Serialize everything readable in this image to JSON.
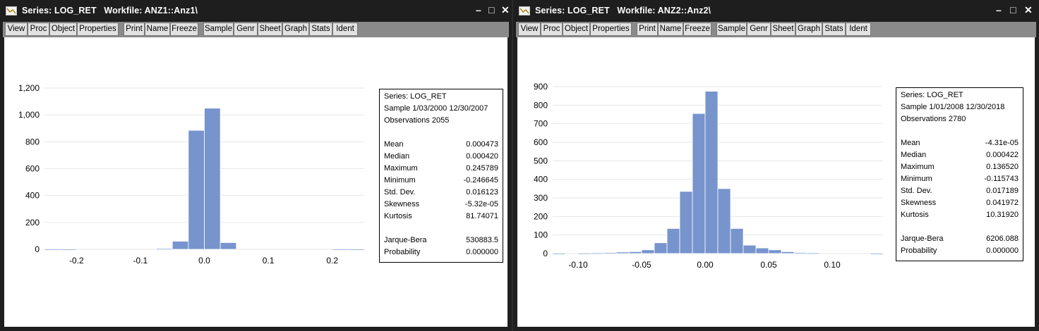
{
  "toolbar_buttons": [
    "View",
    "Proc",
    "Object",
    "Properties",
    "Print",
    "Name",
    "Freeze",
    "Sample",
    "Genr",
    "Sheet",
    "Graph",
    "Stats",
    "Ident"
  ],
  "window_controls": {
    "minimize": "–",
    "maximize": "□",
    "close": "✕"
  },
  "icons": {
    "title": "series-icon"
  },
  "colors": {
    "bar": "#7794cd",
    "bar_edge": "#ffffff",
    "grid": "#e6e6e6",
    "title_bg": "#1e1e1e",
    "toolbar_bg": "#8a8a8a"
  },
  "windows": [
    {
      "title": "Series: LOG_RET   Workfile: ANZ1::Anz1\\",
      "stats": {
        "series": "Series: LOG_RET",
        "sample": "Sample 1/03/2000 12/30/2007",
        "observations": "Observations 2055",
        "rows": [
          {
            "label": "Mean",
            "value": "0.000473"
          },
          {
            "label": "Median",
            "value": "0.000420"
          },
          {
            "label": "Maximum",
            "value": "0.245789"
          },
          {
            "label": "Minimum",
            "value": "-0.246645"
          },
          {
            "label": "Std. Dev.",
            "value": "0.016123"
          },
          {
            "label": "Skewness",
            "value": "-5.32e-05"
          },
          {
            "label": "Kurtosis",
            "value": "81.74071"
          }
        ],
        "tests": [
          {
            "label": "Jarque-Bera",
            "value": "530883.5"
          },
          {
            "label": "Probability",
            "value": "0.000000"
          }
        ]
      }
    },
    {
      "title": "Series: LOG_RET   Workfile: ANZ2::Anz2\\",
      "stats": {
        "series": "Series: LOG_RET",
        "sample": "Sample 1/01/2008 12/30/2018",
        "observations": "Observations 2780",
        "rows": [
          {
            "label": "Mean",
            "value": "-4.31e-05"
          },
          {
            "label": "Median",
            "value": "0.000422"
          },
          {
            "label": "Maximum",
            "value": "0.136520"
          },
          {
            "label": "Minimum",
            "value": "-0.115743"
          },
          {
            "label": "Std. Dev.",
            "value": "0.017189"
          },
          {
            "label": "Skewness",
            "value": "0.041972"
          },
          {
            "label": "Kurtosis",
            "value": "10.31920"
          }
        ],
        "tests": [
          {
            "label": "Jarque-Bera",
            "value": "6206.088"
          },
          {
            "label": "Probability",
            "value": "0.000000"
          }
        ]
      }
    }
  ],
  "chart_data": [
    {
      "type": "bar",
      "subtype": "histogram",
      "series_name": "LOG_RET",
      "bin_width": 0.025,
      "bin_start": -0.25,
      "bins": [
        -0.25,
        -0.225,
        -0.2,
        -0.175,
        -0.15,
        -0.125,
        -0.1,
        -0.075,
        -0.05,
        -0.025,
        0.0,
        0.025,
        0.05,
        0.075,
        0.1,
        0.125,
        0.15,
        0.175,
        0.2,
        0.225
      ],
      "values": [
        1,
        1,
        0,
        0,
        0,
        0,
        0,
        5,
        60,
        885,
        1050,
        50,
        0,
        0,
        0,
        0,
        0,
        0,
        1,
        1
      ],
      "xlim": [
        -0.25,
        0.25
      ],
      "ylim": [
        0,
        1200
      ],
      "yticks": [
        0,
        200,
        400,
        600,
        800,
        1000,
        1200
      ],
      "ytick_labels": [
        "0",
        "200",
        "400",
        "600",
        "800",
        "1,000",
        "1,200"
      ],
      "xticks": [
        -0.2,
        -0.1,
        0.0,
        0.1,
        0.2
      ],
      "xtick_labels": [
        "-0.2",
        "-0.1",
        "0.0",
        "0.1",
        "0.2"
      ],
      "grid": true
    },
    {
      "type": "bar",
      "subtype": "histogram",
      "series_name": "LOG_RET",
      "bin_width": 0.01,
      "bin_start": -0.12,
      "bins": [
        -0.12,
        -0.11,
        -0.1,
        -0.09,
        -0.08,
        -0.07,
        -0.06,
        -0.05,
        -0.04,
        -0.03,
        -0.02,
        -0.01,
        0.0,
        0.01,
        0.02,
        0.03,
        0.04,
        0.05,
        0.06,
        0.07,
        0.08,
        0.09,
        0.1,
        0.11,
        0.12,
        0.13
      ],
      "values": [
        1,
        0,
        2,
        3,
        5,
        8,
        10,
        20,
        58,
        135,
        335,
        755,
        875,
        350,
        135,
        45,
        30,
        20,
        10,
        5,
        3,
        0,
        0,
        0,
        0,
        1
      ],
      "xlim": [
        -0.12,
        0.14
      ],
      "ylim": [
        0,
        900
      ],
      "yticks": [
        0,
        100,
        200,
        300,
        400,
        500,
        600,
        700,
        800,
        900
      ],
      "ytick_labels": [
        "0",
        "100",
        "200",
        "300",
        "400",
        "500",
        "600",
        "700",
        "800",
        "900"
      ],
      "xticks": [
        -0.1,
        -0.05,
        0.0,
        0.05,
        0.1
      ],
      "xtick_labels": [
        "-0.10",
        "-0.05",
        "0.00",
        "0.05",
        "0.10"
      ],
      "grid": true
    }
  ]
}
